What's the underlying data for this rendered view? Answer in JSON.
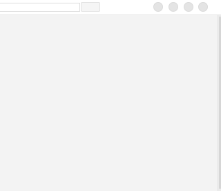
{
  "toolbar": {
    "search_placeholder": "",
    "search_value": "",
    "search_button_label": "",
    "actions": [
      {
        "name": "action-1",
        "icon": "circle-icon"
      },
      {
        "name": "action-2",
        "icon": "circle-icon"
      },
      {
        "name": "action-3",
        "icon": "circle-icon"
      },
      {
        "name": "action-4",
        "icon": "circle-icon"
      }
    ]
  },
  "content": {
    "body_text": ""
  },
  "colors": {
    "toolbar_bg": "#ffffff",
    "content_bg": "#f3f3f3",
    "button_bg": "#e4e4e4"
  }
}
